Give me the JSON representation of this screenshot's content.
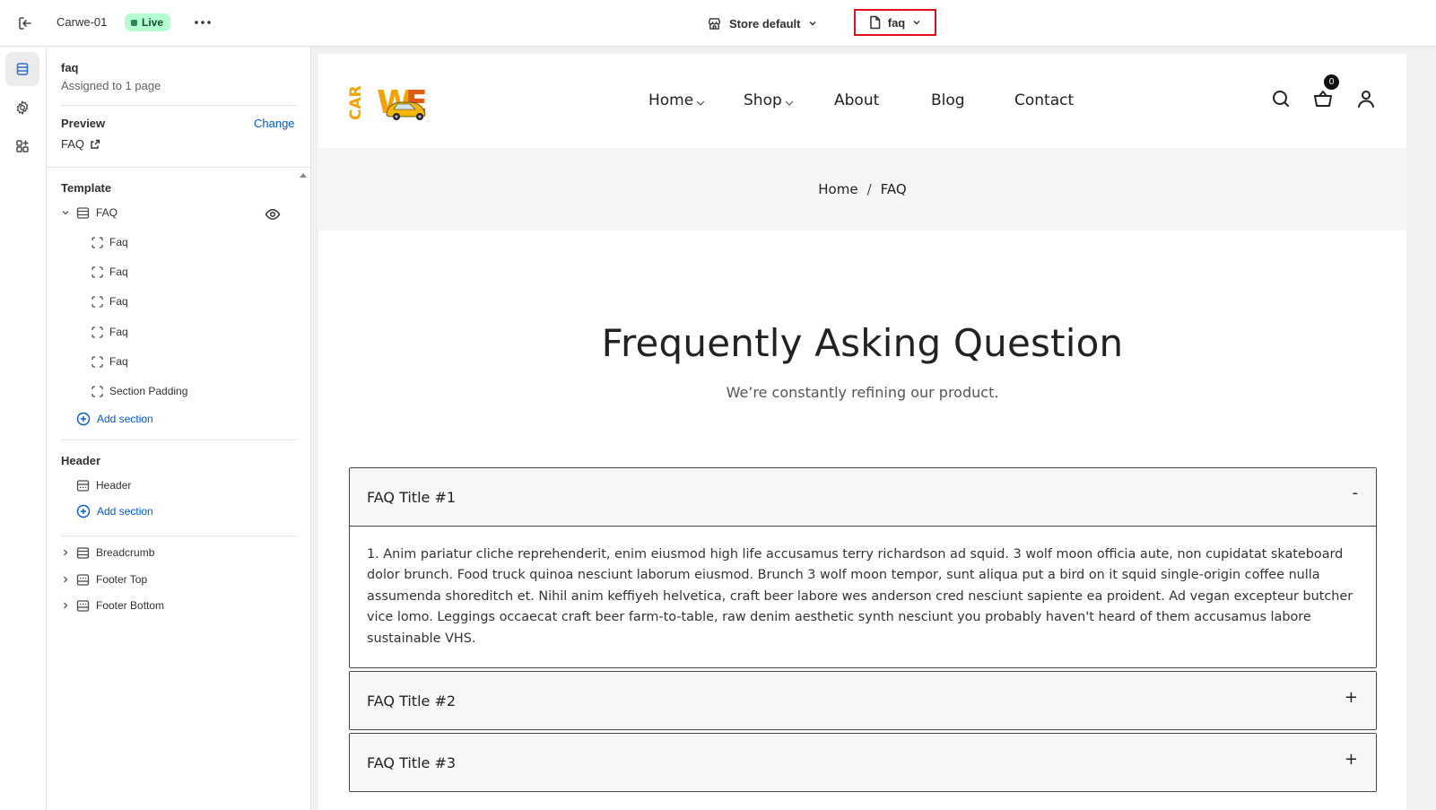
{
  "topbar": {
    "store_name": "Carwe-01",
    "live_badge": "Live",
    "store_selector": "Store default",
    "page_selector": "faq"
  },
  "sidebar": {
    "title": "faq",
    "subtitle": "Assigned to 1 page",
    "preview_label": "Preview",
    "change_label": "Change",
    "preview_page": "FAQ",
    "template": {
      "group_label": "Template",
      "root_label": "FAQ",
      "items": [
        {
          "label": "Faq"
        },
        {
          "label": "Faq"
        },
        {
          "label": "Faq"
        },
        {
          "label": "Faq"
        },
        {
          "label": "Faq"
        },
        {
          "label": "Section Padding"
        }
      ],
      "add_section": "Add section"
    },
    "header": {
      "group_label": "Header",
      "items": [
        {
          "label": "Header"
        }
      ],
      "add_section": "Add section"
    },
    "footer_groups": [
      {
        "label": "Breadcrumb"
      },
      {
        "label": "Footer Top"
      },
      {
        "label": "Footer Bottom"
      }
    ]
  },
  "site": {
    "nav": {
      "home": "Home",
      "shop": "Shop",
      "about": "About",
      "blog": "Blog",
      "contact": "Contact"
    },
    "cart_count": "0",
    "breadcrumb": {
      "home": "Home",
      "separator": "/",
      "current": "FAQ"
    },
    "faq_heading": "Frequently Asking Question",
    "faq_subheading": "We’re constantly refining our product.",
    "faqs": [
      {
        "title": "FAQ Title #1",
        "toggle": "-",
        "expanded": true,
        "body": "1. Anim pariatur cliche reprehenderit, enim eiusmod high life accusamus terry richardson ad squid. 3 wolf moon officia aute, non cupidatat skateboard dolor brunch. Food truck quinoa nesciunt laborum eiusmod. Brunch 3 wolf moon tempor, sunt aliqua put a bird on it squid single-origin coffee nulla assumenda shoreditch et. Nihil anim keffiyeh helvetica, craft beer labore wes anderson cred nesciunt sapiente ea proident. Ad vegan excepteur butcher vice lomo. Leggings occaecat craft beer farm-to-table, raw denim aesthetic synth nesciunt you probably haven't heard of them accusamus labore sustainable VHS."
      },
      {
        "title": "FAQ Title #2",
        "toggle": "+",
        "expanded": false
      },
      {
        "title": "FAQ Title #3",
        "toggle": "+",
        "expanded": false
      }
    ]
  },
  "icons": {
    "exit": "exit-icon",
    "more": "more-horizontal-icon",
    "store": "store-icon",
    "page": "page-icon",
    "sections": "sections-icon",
    "settings": "gear-icon",
    "apps": "apps-icon",
    "external": "external-link-icon",
    "eye": "eye-icon",
    "search": "search-icon",
    "cart": "cart-icon",
    "account": "account-icon"
  },
  "colors": {
    "live_badge_bg": "#b4fed2",
    "link_blue": "#005bd3",
    "page_selector_outline": "#e0101b",
    "logo_orange": "#f5a300"
  }
}
